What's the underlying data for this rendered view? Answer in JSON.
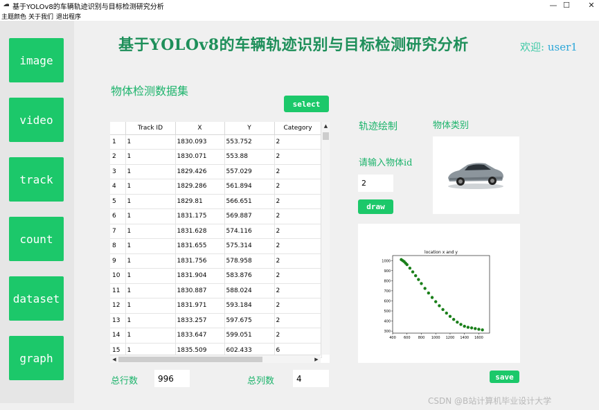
{
  "window": {
    "title": "基于YOLOv8的车辆轨迹识别与目标检测研究分析",
    "controls": [
      "—",
      "☐",
      "✕"
    ]
  },
  "menu": [
    "主题颜色",
    "关于我们",
    "退出程序"
  ],
  "sidebar": [
    "image",
    "video",
    "track",
    "count",
    "dataset",
    "graph"
  ],
  "header": {
    "title": "基于YOLOv8的车辆轨迹识别与目标检测研究分析",
    "welcome_label": "欢迎:",
    "username": "user1"
  },
  "dataset_section": {
    "label": "物体检测数据集",
    "select_label": "select"
  },
  "table": {
    "columns": [
      "",
      "Track ID",
      "X",
      "Y",
      "Category"
    ],
    "rows": [
      [
        "1",
        "1",
        "1830.093",
        "553.752",
        "2"
      ],
      [
        "2",
        "1",
        "1830.071",
        "553.88",
        "2"
      ],
      [
        "3",
        "1",
        "1829.426",
        "557.029",
        "2"
      ],
      [
        "4",
        "1",
        "1829.286",
        "561.894",
        "2"
      ],
      [
        "5",
        "1",
        "1829.81",
        "566.651",
        "2"
      ],
      [
        "6",
        "1",
        "1831.175",
        "569.887",
        "2"
      ],
      [
        "7",
        "1",
        "1831.628",
        "574.116",
        "2"
      ],
      [
        "8",
        "1",
        "1831.655",
        "575.314",
        "2"
      ],
      [
        "9",
        "1",
        "1831.756",
        "578.958",
        "2"
      ],
      [
        "10",
        "1",
        "1831.904",
        "583.876",
        "2"
      ],
      [
        "11",
        "1",
        "1830.887",
        "588.024",
        "2"
      ],
      [
        "12",
        "1",
        "1831.971",
        "593.184",
        "2"
      ],
      [
        "13",
        "1",
        "1833.257",
        "597.675",
        "2"
      ],
      [
        "14",
        "1",
        "1833.647",
        "599.051",
        "2"
      ],
      [
        "15",
        "1",
        "1835.509",
        "602.433",
        "6"
      ]
    ]
  },
  "footer": {
    "rows_label": "总行数",
    "rows_value": "996",
    "cols_label": "总列数",
    "cols_value": "4"
  },
  "trajectory": {
    "label": "轨迹绘制",
    "category_label": "物体类别",
    "input_label": "请输入物体id",
    "input_value": "2",
    "draw_label": "draw",
    "save_label": "save"
  },
  "watermark": "CSDN @B站计算机毕业设计大学",
  "chart_data": {
    "type": "scatter",
    "title": "location x and y",
    "xlabel": "",
    "ylabel": "",
    "xlim": [
      400,
      1750
    ],
    "ylim": [
      280,
      1050
    ],
    "xticks": [
      400,
      600,
      800,
      1000,
      1200,
      1400,
      1600
    ],
    "yticks": [
      300,
      400,
      500,
      600,
      700,
      800,
      900,
      1000
    ],
    "color": "#1a7f1a",
    "x": [
      520,
      540,
      560,
      580,
      600,
      640,
      680,
      720,
      760,
      800,
      850,
      900,
      950,
      1000,
      1050,
      1100,
      1150,
      1200,
      1250,
      1300,
      1350,
      1400,
      1450,
      1500,
      1550,
      1600,
      1650
    ],
    "y": [
      1010,
      1000,
      990,
      975,
      960,
      925,
      888,
      850,
      812,
      772,
      724,
      678,
      634,
      592,
      552,
      514,
      479,
      446,
      416,
      389,
      366,
      348,
      338,
      332,
      325,
      318,
      312
    ]
  }
}
